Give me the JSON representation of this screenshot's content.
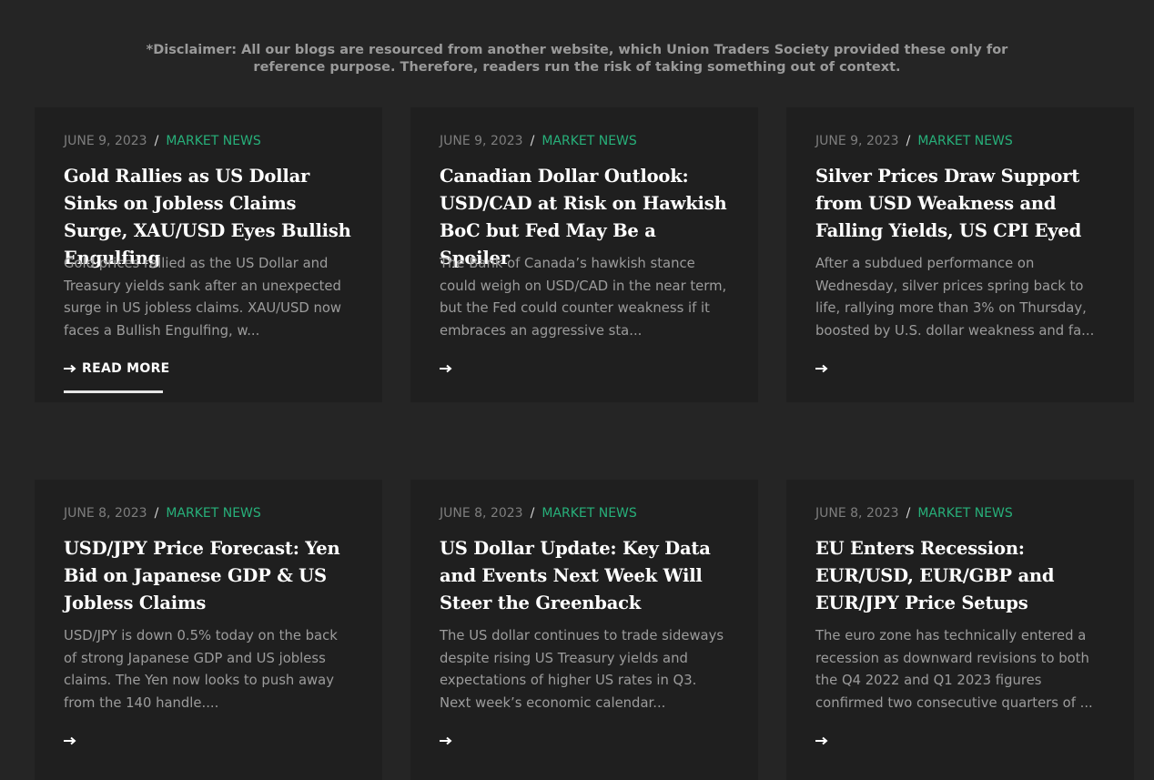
{
  "disclaimer": {
    "line1": "*Disclaimer: All our blogs are resourced from another website, which Union Traders Society provided these only for",
    "line2": "reference purpose. Therefore, readers run the risk of taking something out of context."
  },
  "posts": [
    {
      "date": "JUNE 9, 2023",
      "separator": "/",
      "category": "MARKET NEWS",
      "title": "Gold Rallies as US Dollar Sinks on Jobless Claims Surge, XAU/USD Eyes Bullish Engulfing",
      "excerpt": "Gold prices rallied as the US Dollar and Treasury yields sank after an unexpected surge in US jobless claims. XAU/USD now faces a Bullish Engulfing, w...",
      "read_more_label": "READ MORE",
      "arrow_icon": "arrow-right-icon"
    },
    {
      "date": "JUNE 9, 2023",
      "separator": "/",
      "category": "MARKET NEWS",
      "title": "Canadian Dollar Outlook: USD/CAD at Risk on Hawkish BoC but Fed May Be a Spoiler",
      "excerpt": "The Bank of Canada’s hawkish stance could weigh on USD/CAD in the near term, but the Fed could counter weakness if it embraces an aggressive sta...",
      "read_more_label": "",
      "arrow_icon": "arrow-right-icon"
    },
    {
      "date": "JUNE 9, 2023",
      "separator": "/",
      "category": "MARKET NEWS",
      "title": "Silver Prices Draw Support from USD Weakness and Falling Yields, US CPI Eyed",
      "excerpt": "After a subdued performance on Wednesday, silver prices spring back to life, rallying more than 3% on Thursday, boosted by U.S. dollar weakness and fa...",
      "read_more_label": "",
      "arrow_icon": "arrow-right-icon"
    },
    {
      "date": "JUNE 8, 2023",
      "separator": "/",
      "category": "MARKET NEWS",
      "title": "USD/JPY Price Forecast: Yen Bid on Japanese GDP & US Jobless Claims",
      "excerpt": "USD/JPY is down 0.5% today on the back of strong Japanese GDP and US jobless claims. The Yen now looks to push away from the 140 handle....",
      "read_more_label": "",
      "arrow_icon": "arrow-right-icon"
    },
    {
      "date": "JUNE 8, 2023",
      "separator": "/",
      "category": "MARKET NEWS",
      "title": "US Dollar Update: Key Data and Events Next Week Will Steer the Greenback",
      "excerpt": "The US dollar continues to trade sideways despite rising US Treasury yields and expectations of higher US rates in Q3. Next week’s economic calendar...",
      "read_more_label": "",
      "arrow_icon": "arrow-right-icon"
    },
    {
      "date": "JUNE 8, 2023",
      "separator": "/",
      "category": "MARKET NEWS",
      "title": "EU Enters Recession: EUR/USD, EUR/GBP and EUR/JPY Price Setups",
      "excerpt": "The euro zone has technically entered a recession as downward revisions to both the Q4 2022 and Q1 2023 figures confirmed two consecutive quarters of ...",
      "read_more_label": "",
      "arrow_icon": "arrow-right-icon"
    }
  ],
  "colors": {
    "background": "#252525",
    "card": "#1f1f1f",
    "category": "#27b07a",
    "date": "#7e7e7e",
    "title": "#ffffff",
    "excerpt": "#9c9c9c"
  }
}
